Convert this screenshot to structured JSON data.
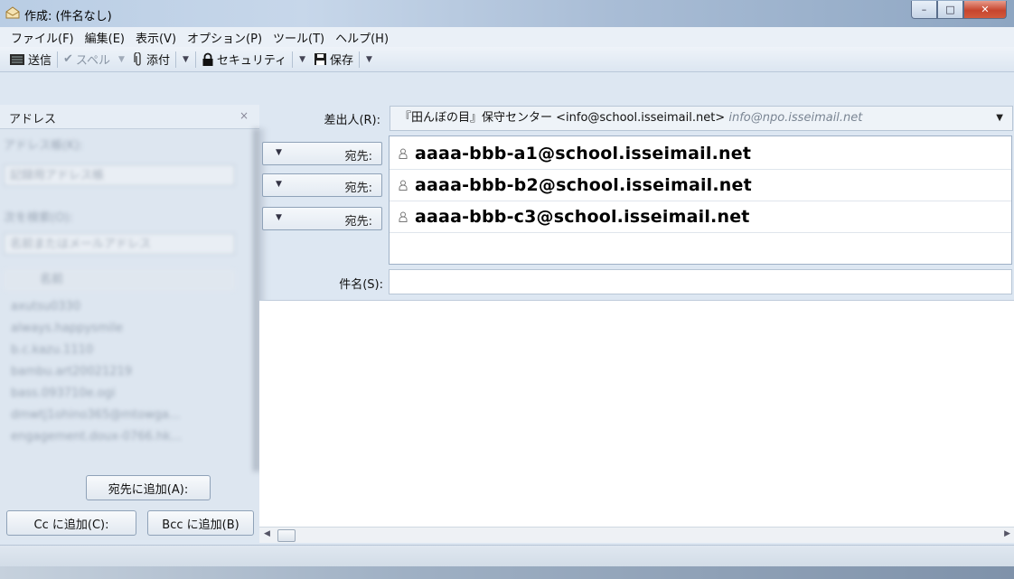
{
  "window": {
    "title": "作成: (件名なし)",
    "controls": {
      "minimize": "–",
      "maximize": "□",
      "close": "✕"
    }
  },
  "menu": [
    "ファイル(F)",
    "編集(E)",
    "表示(V)",
    "オプション(P)",
    "ツール(T)",
    "ヘルプ(H)"
  ],
  "toolbar": {
    "send": "送信",
    "spell": "スペル",
    "attach": "添付",
    "security": "セキュリティ",
    "save": "保存"
  },
  "address_pane": {
    "title": "アドレス",
    "close": "×",
    "book_label": "アドレス帳(K):",
    "book_value": "記録用アドレス帳",
    "search_label": "次を検索(O):",
    "search_placeholder": "名前またはメールアドレス",
    "column_name": "名前",
    "contacts": [
      "axutsu0330",
      "always.happysmile",
      "b.c.kazu.1110",
      "bambu.art20021219",
      "bass.093710e.ogi",
      "dmwtj1ohino365@mtowga...",
      "engagement.doux-0766.hk..."
    ],
    "add_to": "宛先に追加(A):",
    "add_cc": "Cc に追加(C):",
    "add_bcc": "Bcc に追加(B)"
  },
  "compose": {
    "from_label": "差出人(R):",
    "from_value": "『田んぼの目』保守センター <info@school.isseimail.net>",
    "from_alt": "info@npo.isseimail.net",
    "recipient_type": "宛先:",
    "recipients": [
      "aaaa-bbb-a1@school.isseimail.net",
      "aaaa-bbb-b2@school.isseimail.net",
      "aaaa-bbb-c3@school.isseimail.net"
    ],
    "subject_label": "件名(S):",
    "subject_value": ""
  },
  "colors": {
    "accent": "#c7452e",
    "chrome": "#dde7f2"
  }
}
